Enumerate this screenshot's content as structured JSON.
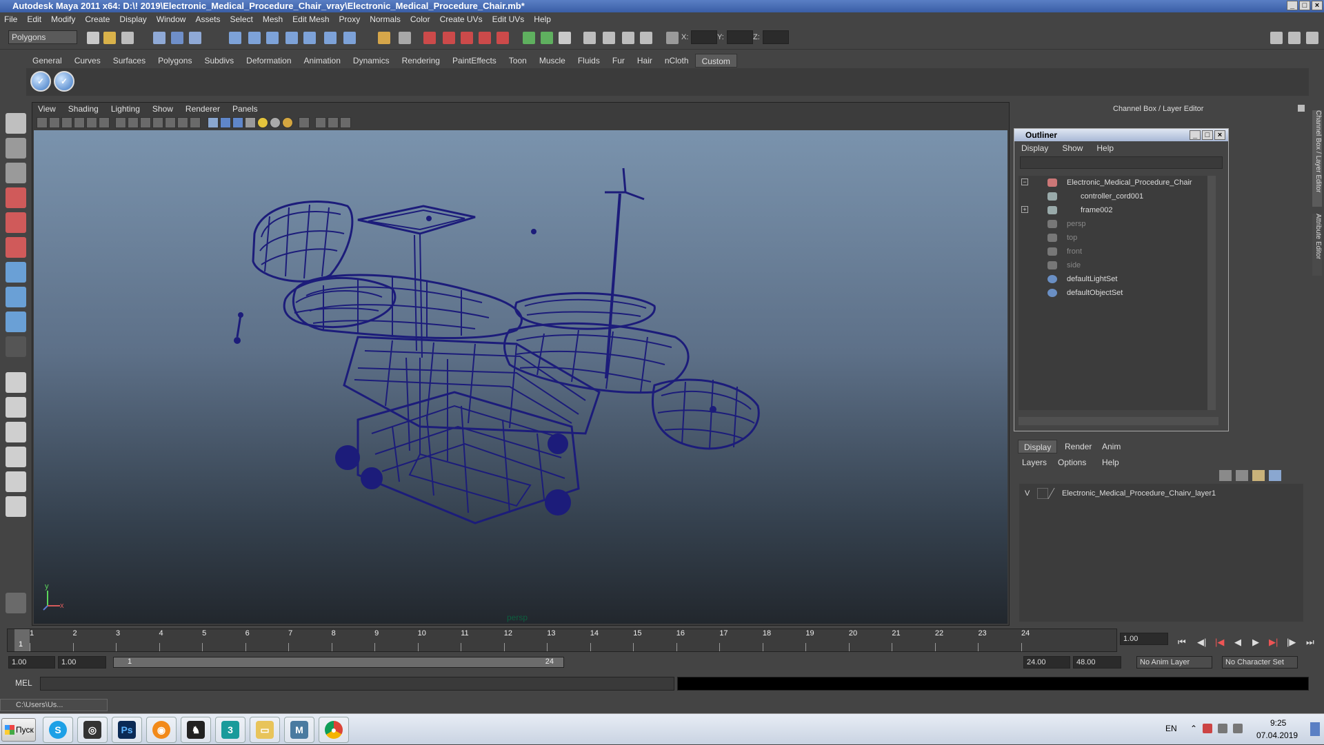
{
  "window": {
    "title": "Autodesk Maya 2011 x64: D:\\! 2019\\Electronic_Medical_Procedure_Chair_vray\\Electronic_Medical_Procedure_Chair.mb*"
  },
  "menubar": [
    "File",
    "Edit",
    "Modify",
    "Create",
    "Display",
    "Window",
    "Assets",
    "Select",
    "Mesh",
    "Edit Mesh",
    "Proxy",
    "Normals",
    "Color",
    "Create UVs",
    "Edit UVs",
    "Help"
  ],
  "statusline": {
    "mode_dropdown": "Polygons",
    "x_label": "X:",
    "y_label": "Y:",
    "z_label": "Z:"
  },
  "shelf": {
    "tabs": [
      "General",
      "Curves",
      "Surfaces",
      "Polygons",
      "Subdivs",
      "Deformation",
      "Animation",
      "Dynamics",
      "Rendering",
      "PaintEffects",
      "Toon",
      "Muscle",
      "Fluids",
      "Fur",
      "Hair",
      "nCloth",
      "Custom"
    ],
    "active_tab": "Custom"
  },
  "viewport": {
    "menu": [
      "View",
      "Shading",
      "Lighting",
      "Show",
      "Renderer",
      "Panels"
    ],
    "camera_label": "persp",
    "axis_y": "y",
    "axis_x": "x"
  },
  "channel_box": {
    "title": "Channel Box / Layer Editor"
  },
  "side_tabs": [
    "Channel Box / Layer Editor",
    "Attribute Editor"
  ],
  "outliner": {
    "title": "Outliner",
    "menu": [
      "Display",
      "Show",
      "Help"
    ],
    "items": [
      {
        "label": "Electronic_Medical_Procedure_Chair",
        "dim": false
      },
      {
        "label": "controller_cord001",
        "dim": false
      },
      {
        "label": "frame002",
        "dim": false
      },
      {
        "label": "persp",
        "dim": true
      },
      {
        "label": "top",
        "dim": true
      },
      {
        "label": "front",
        "dim": true
      },
      {
        "label": "side",
        "dim": true
      },
      {
        "label": "defaultLightSet",
        "dim": false
      },
      {
        "label": "defaultObjectSet",
        "dim": false
      }
    ]
  },
  "layer_editor": {
    "tabs": [
      "Display",
      "Render",
      "Anim"
    ],
    "active_tab": "Display",
    "menu": [
      "Layers",
      "Options",
      "Help"
    ],
    "layers": [
      {
        "visible": "V",
        "name": "Electronic_Medical_Procedure_Chairv_layer1"
      }
    ]
  },
  "timeline": {
    "ticks": [
      "1",
      "2",
      "3",
      "4",
      "5",
      "6",
      "7",
      "8",
      "9",
      "10",
      "11",
      "12",
      "13",
      "14",
      "15",
      "16",
      "17",
      "18",
      "19",
      "20",
      "21",
      "22",
      "23",
      "24"
    ],
    "current_frame": "1",
    "current_time_field": "1.00"
  },
  "range": {
    "start": "1.00",
    "playback_start": "1.00",
    "slider_start": "1",
    "slider_end": "24",
    "playback_end": "24.00",
    "end": "48.00",
    "anim_layer": "No Anim Layer",
    "character_set": "No Character Set"
  },
  "command_line": {
    "label": "MEL"
  },
  "minimized_window": {
    "title": "C:\\Users\\Us..."
  },
  "taskbar": {
    "start_label": "Пуск",
    "apps": [
      "skype",
      "maya-launcher",
      "photoshop",
      "blender",
      "inkscape",
      "3ds-max",
      "file-explorer",
      "maya",
      "chrome"
    ],
    "language": "EN",
    "time": "9:25",
    "date": "07.04.2019"
  },
  "colors": {
    "wireframe": "#1c1c7a",
    "title_bar": "#3a5ea6",
    "viewport_top": "#7a93ad",
    "viewport_bottom": "#22272d"
  }
}
